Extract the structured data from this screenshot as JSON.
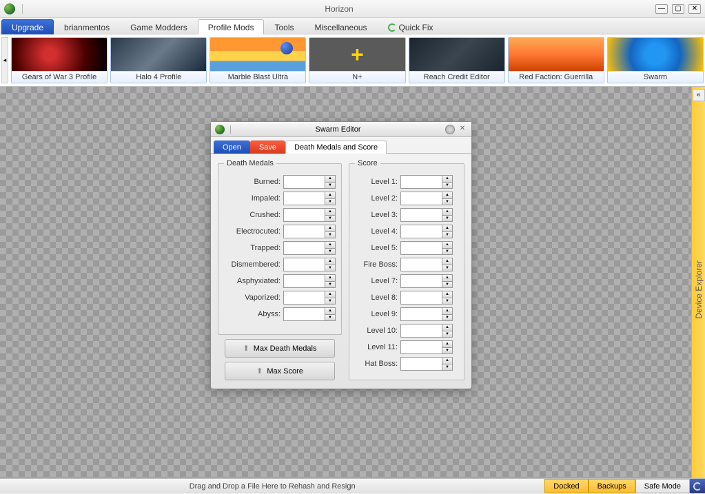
{
  "app": {
    "title": "Horizon"
  },
  "tabs": {
    "upgrade": "Upgrade",
    "items": [
      {
        "label": "brianmentos"
      },
      {
        "label": "Game Modders"
      },
      {
        "label": "Profile Mods",
        "active": true
      },
      {
        "label": "Tools"
      },
      {
        "label": "Miscellaneous"
      },
      {
        "label": "Quick Fix",
        "icon": "refresh"
      }
    ]
  },
  "gallery": [
    {
      "label": "Gears of War 3 Profile",
      "thumb": "gow"
    },
    {
      "label": "Halo 4 Profile",
      "thumb": "halo"
    },
    {
      "label": "Marble Blast Ultra",
      "thumb": "marble"
    },
    {
      "label": "N+",
      "thumb": "nplus"
    },
    {
      "label": "Reach Credit Editor",
      "thumb": "reach"
    },
    {
      "label": "Red Faction: Guerrilla",
      "thumb": "redfac"
    },
    {
      "label": "Swarm",
      "thumb": "swarm"
    }
  ],
  "rightbar": {
    "label": "Device Explorer",
    "collapse": "«"
  },
  "editor": {
    "title": "Swarm Editor",
    "tabs": {
      "open": "Open",
      "save": "Save",
      "active": "Death Medals and Score"
    },
    "death_medals": {
      "legend": "Death Medals",
      "fields": [
        {
          "label": "Burned:",
          "value": ""
        },
        {
          "label": "Impaled:",
          "value": ""
        },
        {
          "label": "Crushed:",
          "value": ""
        },
        {
          "label": "Electrocuted:",
          "value": ""
        },
        {
          "label": "Trapped:",
          "value": ""
        },
        {
          "label": "Dismembered:",
          "value": ""
        },
        {
          "label": "Asphyxiated:",
          "value": ""
        },
        {
          "label": "Vaporized:",
          "value": ""
        },
        {
          "label": "Abyss:",
          "value": ""
        }
      ]
    },
    "score": {
      "legend": "Score",
      "fields": [
        {
          "label": "Level 1:",
          "value": ""
        },
        {
          "label": "Level 2:",
          "value": ""
        },
        {
          "label": "Level 3:",
          "value": ""
        },
        {
          "label": "Level 4:",
          "value": ""
        },
        {
          "label": "Level 5:",
          "value": ""
        },
        {
          "label": "Fire Boss:",
          "value": ""
        },
        {
          "label": "Level 7:",
          "value": ""
        },
        {
          "label": "Level 8:",
          "value": ""
        },
        {
          "label": "Level 9:",
          "value": ""
        },
        {
          "label": "Level 10:",
          "value": ""
        },
        {
          "label": "Level 11:",
          "value": ""
        },
        {
          "label": "Hat Boss:",
          "value": ""
        }
      ]
    },
    "buttons": {
      "max_medals": "Max Death Medals",
      "max_score": "Max Score"
    }
  },
  "statusbar": {
    "drag": "Drag and Drop a File Here to Rehash and Resign",
    "docked": "Docked",
    "backups": "Backups",
    "safemode": "Safe Mode"
  }
}
